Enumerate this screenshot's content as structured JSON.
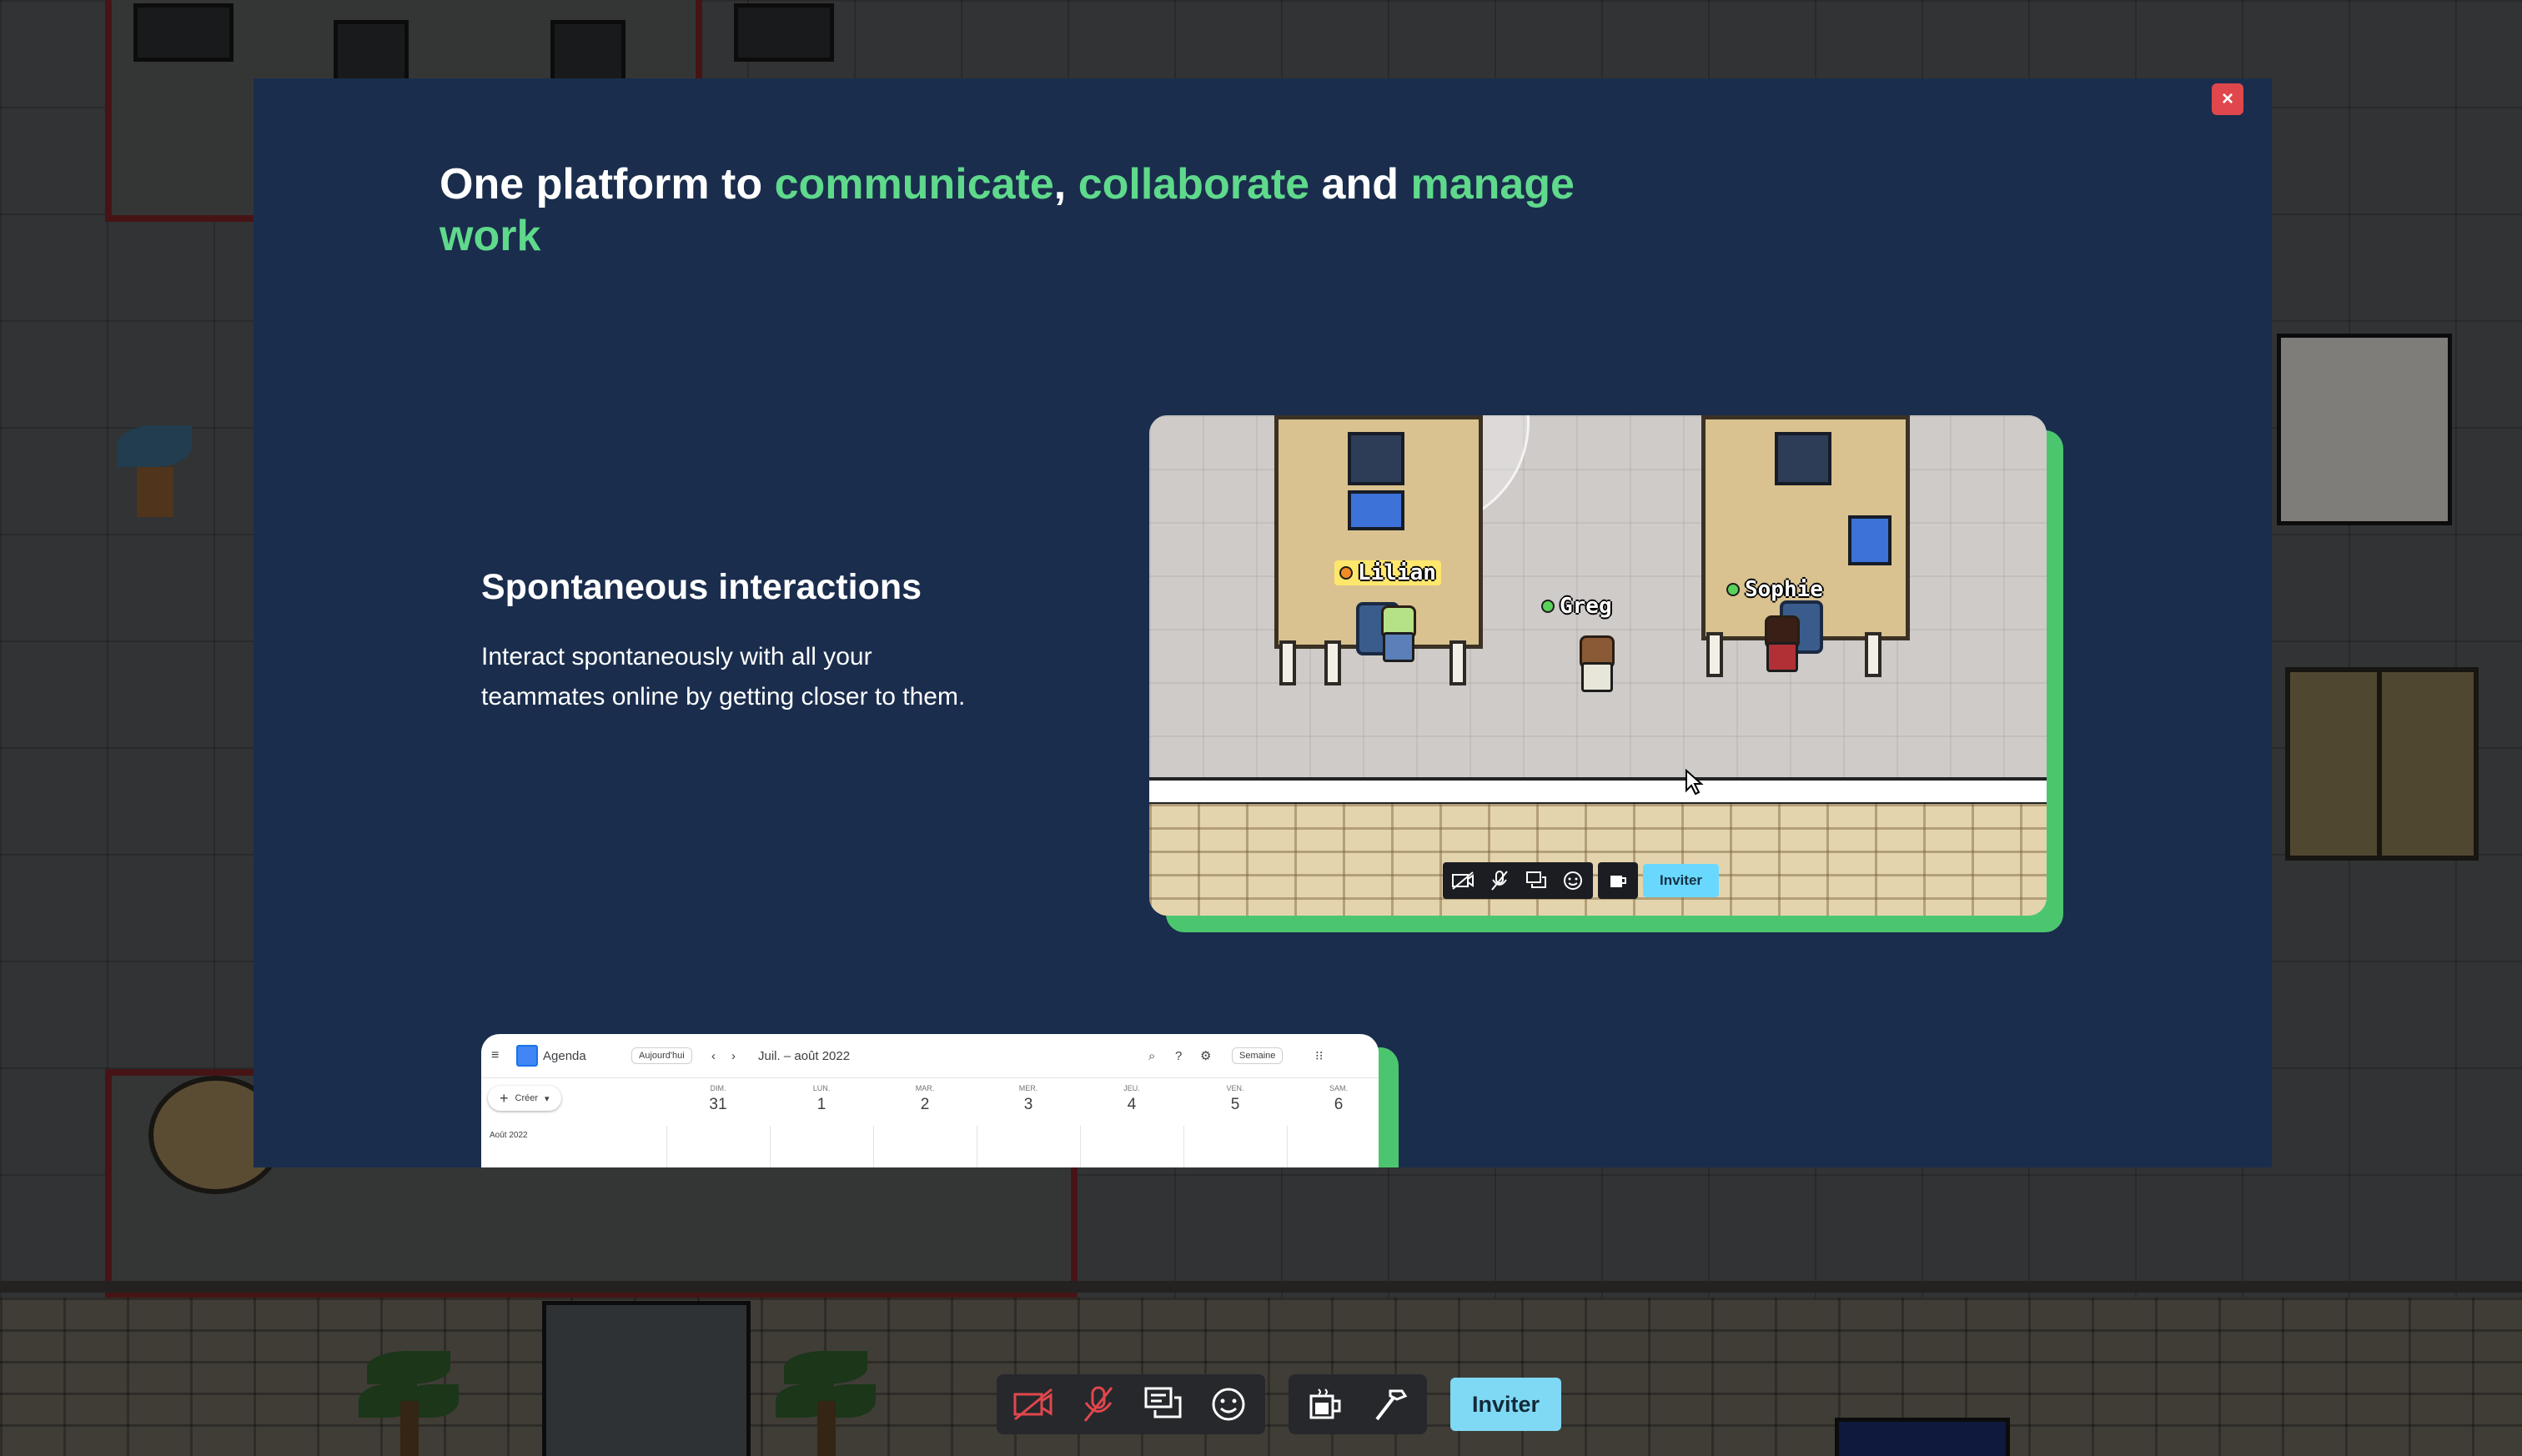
{
  "modal": {
    "close_label": "×",
    "headline": {
      "part1": "One platform to ",
      "hl1": "communicate",
      "part2": ", ",
      "hl2": "collaborate",
      "part3": " and ",
      "hl3": "manage work"
    },
    "feature": {
      "title": "Spontaneous interactions",
      "description": "Interact spontaneously with all your teammates online by getting closer to them."
    },
    "preview": {
      "avatars": [
        "Lilian",
        "Greg",
        "Sophie"
      ],
      "invite_label": "Inviter"
    },
    "calendar": {
      "app_name": "Agenda",
      "today_button": "Aujourd'hui",
      "date_range": "Juil. – août 2022",
      "view_button": "Semaine",
      "create_button": "Créer",
      "mini_month": "Août 2022",
      "days": [
        {
          "name": "DIM.",
          "num": "31"
        },
        {
          "name": "LUN.",
          "num": "1"
        },
        {
          "name": "MAR.",
          "num": "2"
        },
        {
          "name": "MER.",
          "num": "3"
        },
        {
          "name": "JEU.",
          "num": "4"
        },
        {
          "name": "VEN.",
          "num": "5"
        },
        {
          "name": "SAM.",
          "num": "6"
        }
      ]
    }
  },
  "toolbar": {
    "camera_icon": "camera-off-icon",
    "mic_icon": "mic-off-icon",
    "chat_icon": "chat-icon",
    "emoji_icon": "emoji-icon",
    "coffee_icon": "coffee-break-icon",
    "tools_icon": "hammer-icon",
    "invite_label": "Inviter"
  },
  "colors": {
    "modal_bg": "#1a2d4d",
    "accent_green": "#5fd98b",
    "close_red": "#e0474d",
    "invite_blue": "#7fd9f4",
    "icon_off_red": "#e0474d"
  }
}
